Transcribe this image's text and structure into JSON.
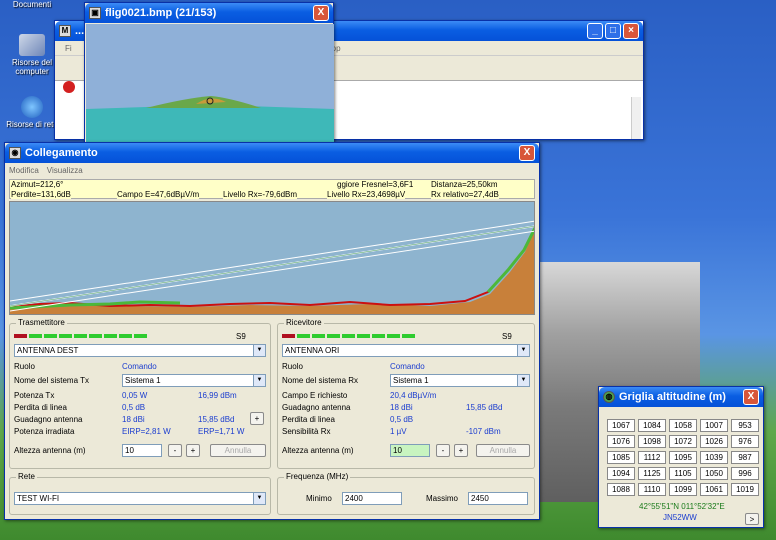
{
  "desktop": {
    "icons": [
      {
        "label": "Documenti"
      },
      {
        "label": "Risorse del computer"
      },
      {
        "label": "Risorse di rete"
      }
    ]
  },
  "main_window": {
    "title": "...\\",
    "menu_fragment": "op",
    "toolbar_fragment": "Fi"
  },
  "bmp_window": {
    "title": "flig0021.bmp (21/153)",
    "close": "X",
    "scroll_left": "<",
    "scroll_right": ">"
  },
  "link_window": {
    "title": "Collegamento",
    "menu": [
      "Modifica",
      "Visualizza"
    ],
    "close": "X",
    "info_row1": {
      "azimut": "Azimut=212,6°",
      "fresnel": "ggiore Fresnel=3,6F1",
      "distanza": "Distanza=25,50km"
    },
    "info_row2": {
      "perdite": "Perdite=131,6dB",
      "campo": "Campo E=47,6dBµV/m",
      "livello_tx": "Livello Rx=-79,6dBm",
      "livello_rx": "Livello Rx=23,4698µV",
      "rx_relativo": "Rx relativo=27,4dB"
    },
    "transmitter": {
      "title": "Trasmettitore",
      "meter_label": "S9",
      "meter_green": 9,
      "meter_red": 3,
      "antenna": "ANTENNA DEST",
      "ruolo_label": "Ruolo",
      "ruolo_value": "Comando",
      "sistema_label": "Nome del sistema Tx",
      "sistema_value": "Sistema  1",
      "potenza_label": "Potenza Tx",
      "potenza_w": "0,05 W",
      "potenza_dbm": "16,99 dBm",
      "perdita_label": "Perdita di linea",
      "perdita_value": "0,5 dB",
      "guadagno_label": "Guadagno antenna",
      "guadagno_dbi": "18 dBi",
      "guadagno_dbd": "15,85 dBd",
      "irradiata_label": "Potenza irradiata",
      "eirp": "EIRP=2,81 W",
      "erp": "ERP=1,71 W",
      "altezza_label": "Altezza antenna (m)",
      "altezza_value": "10",
      "minus": "-",
      "plus": "+",
      "annulla": "Annulla",
      "plus_small": "+"
    },
    "receiver": {
      "title": "Ricevitore",
      "meter_label": "S9",
      "meter_green": 9,
      "meter_red": 3,
      "antenna": "ANTENNA ORI",
      "ruolo_label": "Ruolo",
      "ruolo_value": "Comando",
      "sistema_label": "Nome del sistema Rx",
      "sistema_value": "Sistema  1",
      "campo_label": "Campo E richiesto",
      "campo_value": "20,4 dBµV/m",
      "guadagno_label": "Guadagno antenna",
      "guadagno_dbi": "18 dBi",
      "guadagno_dbd": "15,85 dBd",
      "perdita_label": "Perdita di linea",
      "perdita_value": "0,5 dB",
      "sensibilita_label": "Sensibilità Rx",
      "sens_uv": "1 µV",
      "sens_dbm": "-107 dBm",
      "altezza_label": "Altezza antenna (m)",
      "altezza_value": "10",
      "minus": "-",
      "plus": "+",
      "annulla": "Annulla"
    },
    "rete": {
      "title": "Rete",
      "value": "TEST WI-FI"
    },
    "frequenza": {
      "title": "Frequenza (MHz)",
      "min_label": "Minimo",
      "min_value": "2400",
      "max_label": "Massimo",
      "max_value": "2450"
    }
  },
  "grid_window": {
    "title": "Griglia altitudine (m)",
    "close": "X",
    "rows": [
      [
        "1067",
        "1084",
        "1058",
        "1007",
        "953"
      ],
      [
        "1076",
        "1098",
        "1072",
        "1026",
        "976"
      ],
      [
        "1085",
        "1112",
        "1095",
        "1039",
        "987"
      ],
      [
        "1094",
        "1125",
        "1105",
        "1050",
        "996"
      ],
      [
        "1088",
        "1110",
        "1099",
        "1061",
        "1019"
      ]
    ],
    "coords": "42°55'51\"N  011°52'32\"E",
    "locator": "JN52WW",
    "nav": ">"
  },
  "colors": {
    "title_blue": "#0a5ee2",
    "terrain": "#c8803a",
    "fresnel_red": "#cc1010",
    "meter_green": "#2fcc2f",
    "meter_red": "#b01020"
  }
}
